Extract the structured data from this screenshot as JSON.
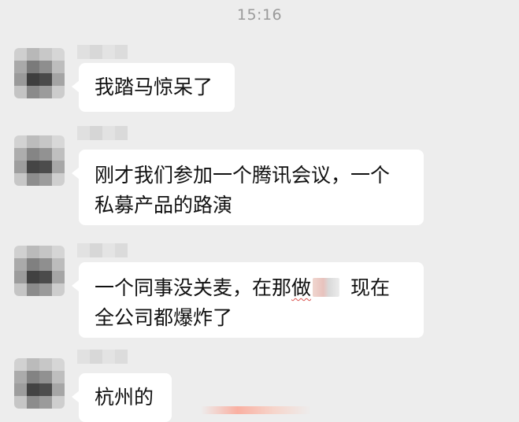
{
  "chat": {
    "timestamp": "15:16",
    "messages": [
      {
        "lines": [
          "我踏马惊呆了"
        ]
      },
      {
        "lines": [
          "刚才我们参加一个腾讯会议，一个",
          "私募产品的路演"
        ]
      },
      {
        "line1_before": "一个同事没关麦，在那",
        "line1_mark": "做",
        "line1_after": "现在",
        "line2": "全公司都爆炸了"
      },
      {
        "lines": [
          "杭州的"
        ]
      }
    ]
  },
  "icons": {
    "avatar": "blurred-avatar-icon",
    "name": "blurred-name-icon",
    "redaction": "redaction-block"
  },
  "colors": {
    "background": "#ededed",
    "bubble": "#ffffff",
    "text": "#111111",
    "timestamp": "#9a9a9a"
  }
}
